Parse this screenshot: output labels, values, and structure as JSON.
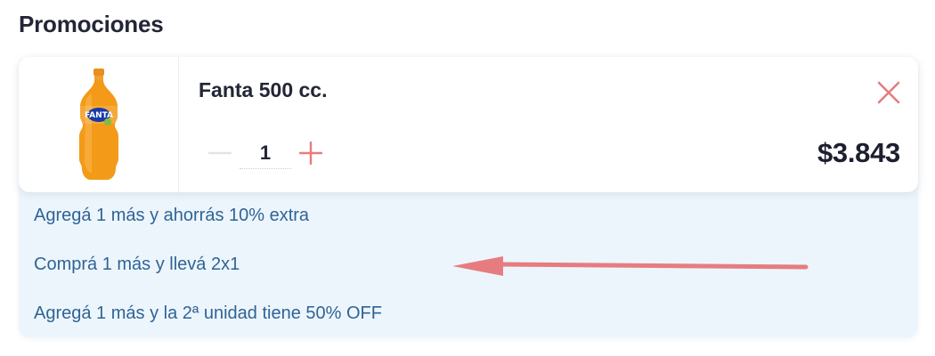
{
  "section": {
    "title": "Promociones"
  },
  "cart_item": {
    "product_name": "Fanta 500 cc.",
    "quantity": "1",
    "price": "$3.843",
    "image_icon": "fanta-bottle-image",
    "remove_icon": "close-icon",
    "decrease_icon": "minus-icon",
    "increase_icon": "plus-icon"
  },
  "promotions": [
    {
      "label": "Agregá 1 más y ahorrás 10% extra"
    },
    {
      "label": "Comprá 1 más y llevá 2x1"
    },
    {
      "label": "Agregá 1 más y la 2ª unidad tiene 50% OFF"
    }
  ],
  "annotation": {
    "icon": "left-arrow-annotation",
    "color": "#e77c80"
  },
  "colors": {
    "text_dark": "#222636",
    "promo_text": "#2e6496",
    "promo_bg": "#edf5fc",
    "accent_red": "#e77c80",
    "bottle_orange": "#f39a18"
  }
}
